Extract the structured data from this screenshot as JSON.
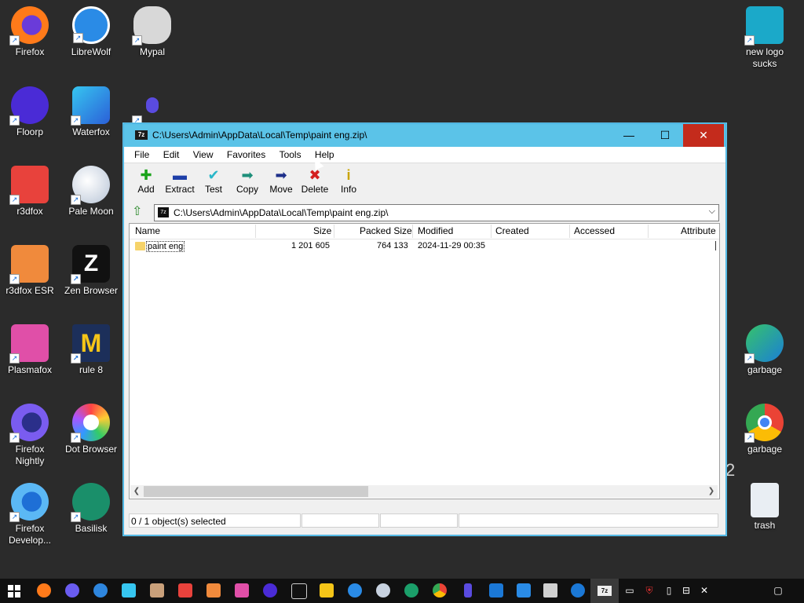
{
  "desktop_icons": {
    "firefox": "Firefox",
    "librewolf": "LibreWolf",
    "mypal": "Mypal",
    "newlogo": "new logo sucks",
    "floorp": "Floorp",
    "waterfox": "Waterfox",
    "r3dfox": "r3dfox",
    "palemoon": "Pale Moon",
    "r3dfoxesr": "r3dfox ESR",
    "zen": "Zen Browser",
    "plasmafox": "Plasmafox",
    "rule8": "rule 8",
    "garbage1": "garbage",
    "ffnightly": "Firefox Nightly",
    "dotbrowser": "Dot Browser",
    "garbage2": "garbage",
    "ffdev": "Firefox Develop...",
    "basilisk": "Basilisk",
    "trash": "trash",
    "partial_text": "2"
  },
  "window": {
    "title": "C:\\Users\\Admin\\AppData\\Local\\Temp\\paint eng.zip\\",
    "app_icon": "7z",
    "menu": [
      "File",
      "Edit",
      "View",
      "Favorites",
      "Tools",
      "Help"
    ],
    "toolbar": [
      "Add",
      "Extract",
      "Test",
      "Copy",
      "Move",
      "Delete",
      "Info"
    ],
    "address": "C:\\Users\\Admin\\AppData\\Local\\Temp\\paint eng.zip\\",
    "columns": [
      "Name",
      "Size",
      "Packed Size",
      "Modified",
      "Created",
      "Accessed",
      "Attribute"
    ],
    "rows": [
      {
        "name": "paint eng",
        "size": "1 201 605",
        "packed": "764 133",
        "modified": "2024-11-29 00:35"
      }
    ],
    "status": "0 / 1 object(s) selected"
  },
  "colors": {
    "titlebar": "#5bc3e8",
    "close": "#c42b1c",
    "desktop": "#2b2b2b",
    "taskbar": "#101010"
  }
}
